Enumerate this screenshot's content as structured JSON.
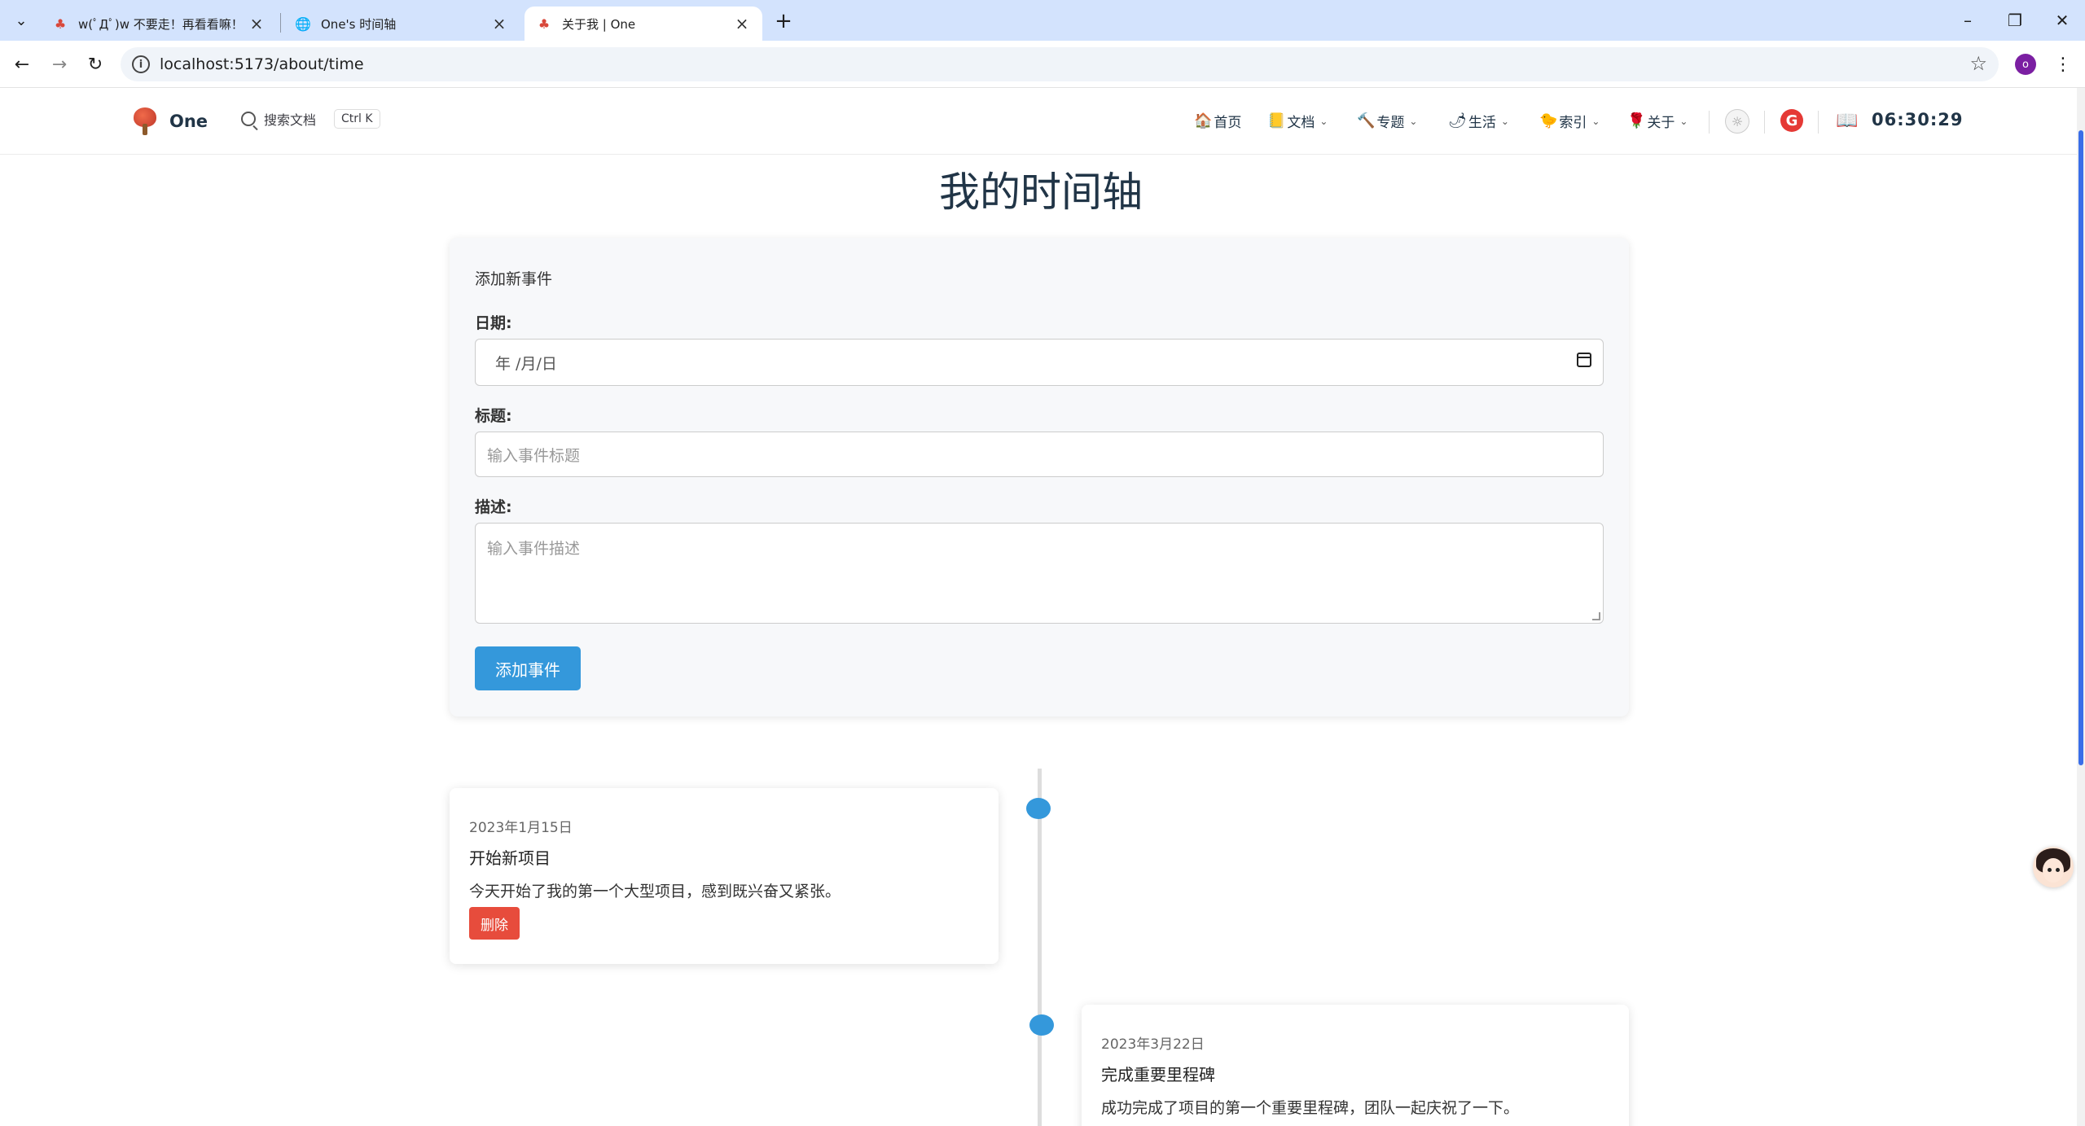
{
  "browser": {
    "tabs": [
      {
        "title": "w(ﾟДﾟ)w 不要走！再看看嘛！",
        "active": false
      },
      {
        "title": "One's 时间轴",
        "active": false
      },
      {
        "title": "关于我 | One",
        "active": true
      }
    ],
    "url": "localhost:5173/about/time",
    "profile_initial": "o"
  },
  "site": {
    "logo_text": "One",
    "search_label": "搜索文档",
    "search_shortcut": "Ctrl K",
    "nav": [
      {
        "icon": "🏠",
        "label": "首页",
        "has_dropdown": false
      },
      {
        "icon": "📒",
        "label": "文档",
        "has_dropdown": true
      },
      {
        "icon": "🔨",
        "label": "专题",
        "has_dropdown": true
      },
      {
        "icon": "🌶",
        "label": "生活",
        "has_dropdown": true
      },
      {
        "icon": "🐤",
        "label": "索引",
        "has_dropdown": true
      },
      {
        "icon": "🌹",
        "label": "关于",
        "has_dropdown": true
      }
    ],
    "clock": "06:30:29"
  },
  "page": {
    "title": "我的时间轴",
    "form": {
      "heading": "添加新事件",
      "date_label": "日期:",
      "date_placeholder": "年 /月/日",
      "title_label": "标题:",
      "title_placeholder": "输入事件标题",
      "desc_label": "描述:",
      "desc_placeholder": "输入事件描述",
      "submit_label": "添加事件"
    },
    "events": [
      {
        "date": "2023年1月15日",
        "title": "开始新项目",
        "description": "今天开始了我的第一个大型项目，感到既兴奋又紧张。",
        "delete_label": "删除"
      },
      {
        "date": "2023年3月22日",
        "title": "完成重要里程碑",
        "description": "成功完成了项目的第一个重要里程碑，团队一起庆祝了一下。"
      }
    ]
  },
  "colors": {
    "accent": "#3498db",
    "danger": "#e74c3c",
    "tabbar": "#d3e3fd"
  }
}
